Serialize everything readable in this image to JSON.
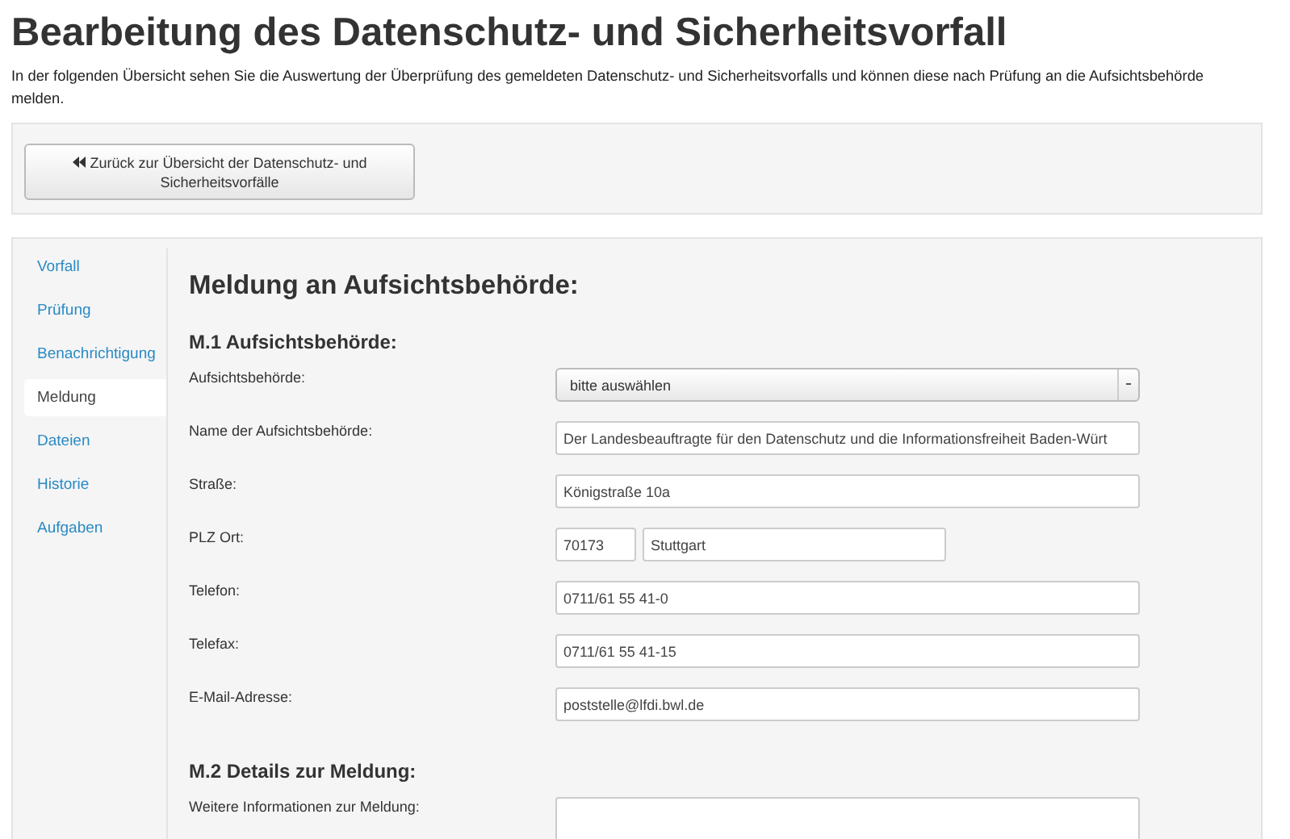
{
  "page": {
    "title": "Bearbeitung des Datenschutz- und Sicherheitsvorfall",
    "intro": "In der folgenden Übersicht sehen Sie die Auswertung der Überprüfung des gemeldeten Datenschutz- und Sicherheitsvorfalls und können diese nach Prüfung an die Aufsichtsbehörde melden."
  },
  "toolbar": {
    "back_button": "Zurück zur Übersicht der Datenschutz- und Sicherheitsvorfälle"
  },
  "sidebar": {
    "items": [
      {
        "label": "Vorfall",
        "selected": false
      },
      {
        "label": "Prüfung",
        "selected": false
      },
      {
        "label": "Benachrichtigung",
        "selected": false
      },
      {
        "label": "Meldung",
        "selected": true
      },
      {
        "label": "Dateien",
        "selected": false
      },
      {
        "label": "Historie",
        "selected": false
      },
      {
        "label": "Aufgaben",
        "selected": false
      }
    ]
  },
  "content": {
    "heading": "Meldung an Aufsichtsbehörde:",
    "sections": [
      {
        "heading": "M.1 Aufsichtsbehörde:",
        "fields": [
          {
            "kind": "select",
            "label": "Aufsichtsbehörde:",
            "value": "bitte auswählen"
          },
          {
            "kind": "text",
            "label": "Name der Aufsichtsbehörde:",
            "value": "Der Landesbeauftragte für den Datenschutz und die Informationsfreiheit Baden-Würt"
          },
          {
            "kind": "text",
            "label": "Straße:",
            "value": "Königstraße 10a"
          },
          {
            "kind": "zipcity",
            "label": "PLZ Ort:",
            "zip": "70173",
            "city": "Stuttgart"
          },
          {
            "kind": "text",
            "label": "Telefon:",
            "value": "0711/61 55 41-0"
          },
          {
            "kind": "text",
            "label": "Telefax:",
            "value": "0711/61 55 41-15"
          },
          {
            "kind": "text",
            "label": "E-Mail-Adresse:",
            "value": "poststelle@lfdi.bwl.de"
          }
        ]
      },
      {
        "heading": "M.2 Details zur Meldung:",
        "fields": [
          {
            "kind": "text",
            "label": "Weitere Informationen zur Meldung:"
          }
        ]
      }
    ]
  }
}
